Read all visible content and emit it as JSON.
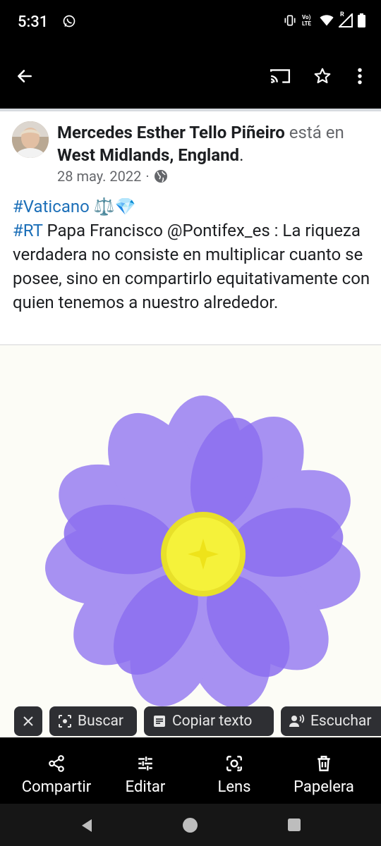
{
  "status_bar": {
    "time": "5:31",
    "volte_label": "Vo) LTE",
    "roaming_label": "R"
  },
  "toolbar": {
    "icons": [
      "back-arrow-icon",
      "cast-icon",
      "star-icon",
      "more-vert-icon"
    ]
  },
  "post": {
    "author_name": "Mercedes Esther Tello Piñeiro",
    "connector_1": "está",
    "connector_2": "en",
    "location": "West Midlands, England",
    "location_suffix": ".",
    "date": "28 may. 2022",
    "separator": "·",
    "line1_hashtag": "#Vaticano",
    "line1_emojis": "⚖️💎",
    "line2_hashtag": "#RT",
    "body": "Papa Francisco @Pontifex_es : La riqueza verdadera no consiste en multiplicar cuanto se posee, sino en compartirlo equitativamente con quien tenemos a nuestro alrededor."
  },
  "colors": {
    "petal": "#9a7ff0",
    "petal_dark": "#8b6cea",
    "center": "#f2ee2e",
    "hashtag": "#1c6fb8"
  },
  "lens_chips": {
    "close_icon": "close-icon",
    "search_label": "Buscar",
    "copy_label": "Copiar texto",
    "listen_label": "Escuchar"
  },
  "bottom_actions": [
    {
      "label": "Compartir",
      "icon": "share-icon"
    },
    {
      "label": "Editar",
      "icon": "tune-icon"
    },
    {
      "label": "Lens",
      "icon": "lens-icon"
    },
    {
      "label": "Papelera",
      "icon": "trash-icon"
    }
  ]
}
